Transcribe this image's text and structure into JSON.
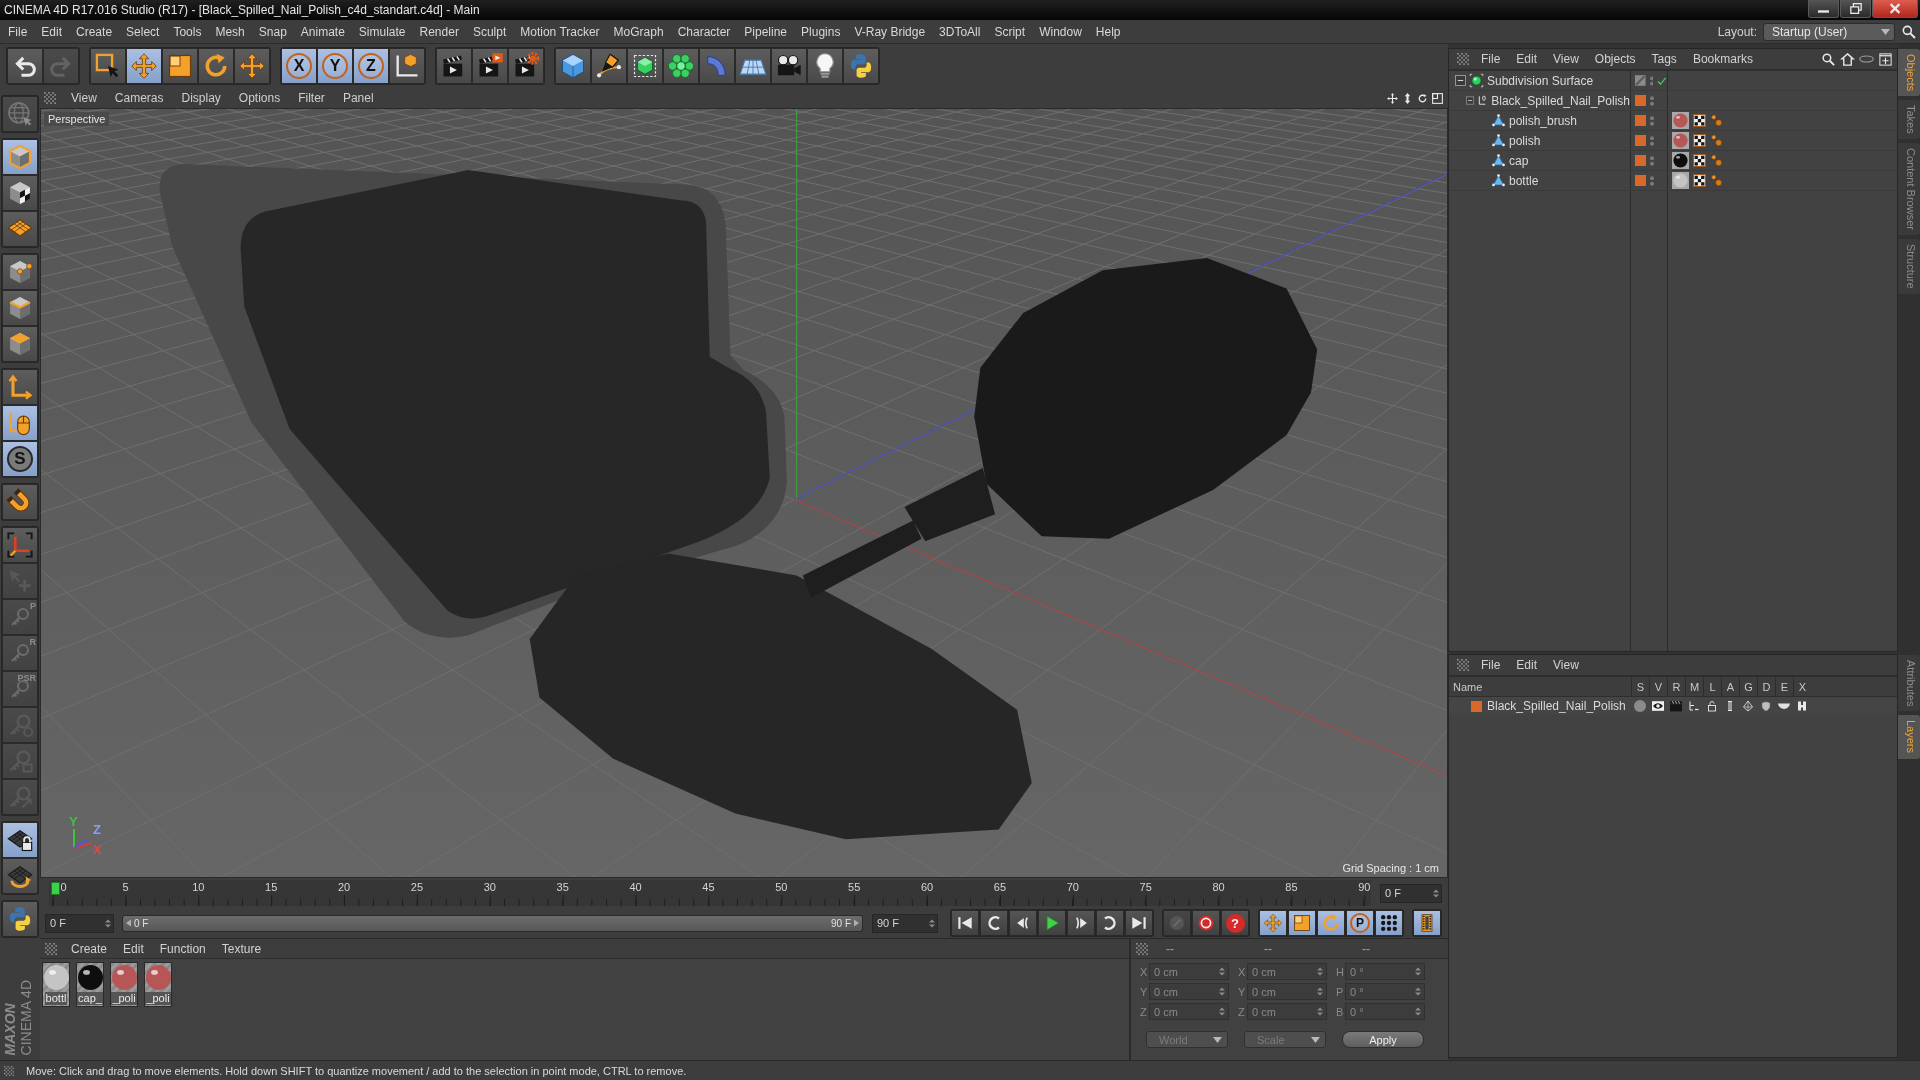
{
  "window": {
    "title": "CINEMA 4D R17.016 Studio (R17) - [Black_Spilled_Nail_Polish_c4d_standart.c4d] - Main"
  },
  "menu_bar": {
    "items": [
      "File",
      "Edit",
      "Create",
      "Select",
      "Tools",
      "Mesh",
      "Snap",
      "Animate",
      "Simulate",
      "Render",
      "Sculpt",
      "Motion Tracker",
      "MoGraph",
      "Character",
      "Pipeline",
      "Plugins",
      "V-Ray Bridge",
      "3DToAll",
      "Script",
      "Window",
      "Help"
    ],
    "layout_label": "Layout:",
    "layout_value": "Startup (User)"
  },
  "toolbar": {
    "groups": [
      {
        "tools": [
          {
            "kind": "undo",
            "selected": false,
            "disabled": false
          },
          {
            "kind": "redo",
            "selected": false,
            "disabled": true
          }
        ]
      },
      {
        "tools": [
          {
            "kind": "selection",
            "selected": false,
            "disabled": false
          },
          {
            "kind": "move",
            "selected": true,
            "disabled": false
          },
          {
            "kind": "scale",
            "selected": false,
            "disabled": false
          },
          {
            "kind": "rotate",
            "selected": false,
            "disabled": false
          },
          {
            "kind": "recent",
            "selected": false,
            "disabled": false
          }
        ]
      },
      {
        "tools": [
          {
            "kind": "axis",
            "label": "X",
            "selected": true,
            "disabled": false
          },
          {
            "kind": "axis",
            "label": "Y",
            "selected": true,
            "disabled": false
          },
          {
            "kind": "axis",
            "label": "Z",
            "selected": true,
            "disabled": false
          },
          {
            "kind": "coord-system",
            "selected": false,
            "disabled": false
          }
        ]
      },
      {
        "tools": [
          {
            "kind": "render-view",
            "selected": false,
            "disabled": false
          },
          {
            "kind": "render-viewer",
            "selected": false,
            "disabled": false
          },
          {
            "kind": "render-settings",
            "selected": false,
            "disabled": false
          }
        ]
      },
      {
        "tools": [
          {
            "kind": "cube",
            "selected": false,
            "disabled": false
          },
          {
            "kind": "pen",
            "selected": false,
            "disabled": false
          },
          {
            "kind": "subdivision",
            "selected": false,
            "disabled": false
          },
          {
            "kind": "cloner",
            "selected": false,
            "disabled": false
          },
          {
            "kind": "bend",
            "selected": false,
            "disabled": false
          },
          {
            "kind": "floor",
            "selected": false,
            "disabled": false
          },
          {
            "kind": "camera",
            "selected": false,
            "disabled": false
          },
          {
            "kind": "light",
            "selected": false,
            "disabled": false
          },
          {
            "kind": "python",
            "selected": false,
            "disabled": false
          }
        ]
      }
    ]
  },
  "tool_column": {
    "groups": [
      {
        "tools": [
          {
            "kind": "globe",
            "selected": false,
            "disabled": true
          }
        ]
      },
      {
        "tools": [
          {
            "kind": "model",
            "selected": true,
            "disabled": false
          },
          {
            "kind": "texture",
            "selected": false,
            "disabled": false
          },
          {
            "kind": "workplane",
            "selected": false,
            "disabled": false
          }
        ]
      },
      {
        "tools": [
          {
            "kind": "points",
            "selected": false,
            "disabled": false
          },
          {
            "kind": "edges",
            "selected": false,
            "disabled": false
          },
          {
            "kind": "polygons",
            "selected": false,
            "disabled": false
          }
        ]
      },
      {
        "tools": [
          {
            "kind": "axis-mode",
            "selected": false,
            "disabled": false
          },
          {
            "kind": "tweak",
            "selected": true,
            "disabled": false
          },
          {
            "kind": "solo",
            "label": "S",
            "selected": true,
            "disabled": false
          }
        ]
      },
      {
        "tools": [
          {
            "kind": "magnet",
            "selected": false,
            "disabled": false
          }
        ]
      },
      {
        "tools": [
          {
            "kind": "workplane-axis",
            "selected": false,
            "disabled": false
          },
          {
            "kind": "cursor-plus",
            "selected": false,
            "disabled": true
          },
          {
            "kind": "key",
            "label": "P",
            "selected": false,
            "disabled": true
          },
          {
            "kind": "key",
            "label": "R",
            "selected": false,
            "disabled": true
          },
          {
            "kind": "key",
            "label": "PSR",
            "selected": false,
            "disabled": true
          },
          {
            "kind": "key-circle",
            "selected": false,
            "disabled": true
          },
          {
            "kind": "key-flag",
            "selected": false,
            "disabled": true
          },
          {
            "kind": "key-arrow",
            "selected": false,
            "disabled": true
          }
        ]
      },
      {
        "tools": [
          {
            "kind": "grid-lock",
            "selected": true,
            "disabled": false
          },
          {
            "kind": "grid-rotate",
            "selected": false,
            "disabled": false
          }
        ]
      },
      {
        "tools": [
          {
            "kind": "python",
            "selected": false,
            "disabled": false
          }
        ]
      }
    ]
  },
  "logo": {
    "brand": "MAXON",
    "product": "CINEMA 4D"
  },
  "viewport": {
    "menu": [
      "View",
      "Cameras",
      "Display",
      "Options",
      "Filter",
      "Panel"
    ],
    "camera": "Perspective",
    "gizmo_labels": [
      {
        "label": "Y",
        "color": "#3cc43c"
      },
      {
        "label": "Z",
        "color": "#8a9cff"
      },
      {
        "label": "X",
        "color": "#e04848"
      }
    ],
    "grid_spacing": "Grid Spacing : 1 cm"
  },
  "timeline": {
    "labels": [
      "0",
      "5",
      "10",
      "15",
      "20",
      "25",
      "30",
      "35",
      "40",
      "45",
      "50",
      "55",
      "60",
      "65",
      "70",
      "75",
      "80",
      "85",
      "90"
    ],
    "level": 0,
    "current_frame": "0 F"
  },
  "playback": {
    "start": "0 F",
    "range": {
      "start": "0 F",
      "end": "90 F",
      "level": 1
    },
    "end": "90 F",
    "groups": [
      {
        "buttons": [
          {
            "kind": "skip-start",
            "selected": false,
            "disabled": false
          },
          {
            "kind": "prev-key",
            "selected": false,
            "disabled": false
          },
          {
            "kind": "step-back",
            "selected": false,
            "disabled": false
          },
          {
            "kind": "play",
            "selected": false,
            "disabled": false
          },
          {
            "kind": "step-forward",
            "selected": false,
            "disabled": false
          },
          {
            "kind": "next-key",
            "selected": false,
            "disabled": false
          },
          {
            "kind": "skip-end",
            "selected": false,
            "disabled": false
          }
        ]
      },
      {
        "buttons": [
          {
            "kind": "record",
            "selected": false,
            "disabled": true
          },
          {
            "kind": "autokey",
            "selected": false,
            "disabled": false
          },
          {
            "kind": "help",
            "label": "?",
            "selected": false,
            "disabled": false
          }
        ]
      },
      {
        "buttons": [
          {
            "kind": "move",
            "selected": true,
            "disabled": false
          },
          {
            "kind": "scale",
            "selected": true,
            "disabled": false
          },
          {
            "kind": "rotate",
            "selected": true,
            "disabled": false
          },
          {
            "kind": "param",
            "label": "P",
            "selected": true,
            "disabled": false
          },
          {
            "kind": "dots",
            "selected": true,
            "disabled": false
          }
        ]
      },
      {
        "buttons": [
          {
            "kind": "film",
            "selected": true,
            "disabled": false
          }
        ]
      }
    ]
  },
  "material_manager": {
    "menu": [
      "Create",
      "Edit",
      "Function",
      "Texture"
    ],
    "materials": [
      {
        "name": "bottl",
        "color": "#c4c4c4"
      },
      {
        "name": "cap_",
        "color": "#0e0e0e"
      },
      {
        "name": "_poli",
        "color": "#b65656"
      },
      {
        "name": "_poli",
        "color": "#b65656"
      }
    ]
  },
  "coordinates": {
    "disabled": true,
    "headers": [
      "--",
      "--",
      "--"
    ],
    "rows": [
      {
        "cells": [
          {
            "axis": "X",
            "value": "0 cm"
          },
          {
            "axis": "X",
            "value": "0 cm"
          },
          {
            "axis": "H",
            "value": "0 °"
          }
        ]
      },
      {
        "cells": [
          {
            "axis": "Y",
            "value": "0 cm"
          },
          {
            "axis": "Y",
            "value": "0 cm"
          },
          {
            "axis": "P",
            "value": "0 °"
          }
        ]
      },
      {
        "cells": [
          {
            "axis": "Z",
            "value": "0 cm"
          },
          {
            "axis": "Z",
            "value": "0 cm"
          },
          {
            "axis": "B",
            "value": "0 °"
          }
        ]
      }
    ],
    "dropdowns": [
      "World",
      "Scale"
    ],
    "apply": "Apply"
  },
  "object_manager": {
    "menu": [
      "File",
      "Edit",
      "View",
      "Objects",
      "Tags",
      "Bookmarks"
    ],
    "objects": [
      {
        "name": "Subdivision Surface",
        "kind": "subdivision",
        "expanded": true,
        "enabled": true,
        "children": [
          {
            "name": "Black_Spilled_Nail_Polish",
            "kind": "null",
            "expanded": true,
            "color": "#d9692a",
            "children": [
              {
                "name": "polish_brush",
                "kind": "polygon",
                "color": "#d9692a",
                "tags": [
                  {
                    "kind": "material",
                    "color": "#b65656"
                  },
                  {
                    "kind": "texture"
                  },
                  {
                    "kind": "phong"
                  }
                ]
              },
              {
                "name": "polish",
                "kind": "polygon",
                "color": "#d9692a",
                "tags": [
                  {
                    "kind": "material",
                    "color": "#b65656"
                  },
                  {
                    "kind": "texture"
                  },
                  {
                    "kind": "phong"
                  }
                ]
              },
              {
                "name": "cap",
                "kind": "polygon",
                "color": "#d9692a",
                "tags": [
                  {
                    "kind": "material",
                    "color": "#0e0e0e"
                  },
                  {
                    "kind": "texture"
                  },
                  {
                    "kind": "phong"
                  }
                ]
              },
              {
                "name": "bottle",
                "kind": "polygon",
                "color": "#d9692a",
                "tags": [
                  {
                    "kind": "material",
                    "color": "#c4c4c4"
                  },
                  {
                    "kind": "texture"
                  },
                  {
                    "kind": "phong"
                  }
                ]
              }
            ]
          }
        ]
      }
    ]
  },
  "layer_manager": {
    "menu": [
      "File",
      "Edit",
      "View"
    ],
    "columns": [
      "Name",
      "S",
      "V",
      "R",
      "M",
      "L",
      "A",
      "G",
      "D",
      "E",
      "X"
    ],
    "layers": [
      {
        "name": "Black_Spilled_Nail_Polish",
        "color": "#d9692a",
        "switches": [
          {
            "kind": "solo"
          },
          {
            "kind": "view"
          },
          {
            "kind": "render"
          },
          {
            "kind": "manager"
          },
          {
            "kind": "lock"
          },
          {
            "kind": "animation"
          },
          {
            "kind": "generators"
          },
          {
            "kind": "deformers"
          },
          {
            "kind": "expressions"
          },
          {
            "kind": "xref"
          }
        ]
      }
    ]
  },
  "side_tabs": {
    "top": [
      {
        "label": "Objects",
        "selected": true
      },
      {
        "label": "Takes",
        "selected": false
      },
      {
        "label": "Content Browser",
        "selected": false
      },
      {
        "label": "Structure",
        "selected": false
      }
    ],
    "bottom": [
      {
        "label": "Attributes",
        "selected": false
      },
      {
        "label": "Layers",
        "selected": true
      }
    ]
  },
  "status_bar": {
    "text": "Move: Click and drag to move elements. Hold down SHIFT to quantize movement / add to the selection in point mode, CTRL to remove."
  }
}
